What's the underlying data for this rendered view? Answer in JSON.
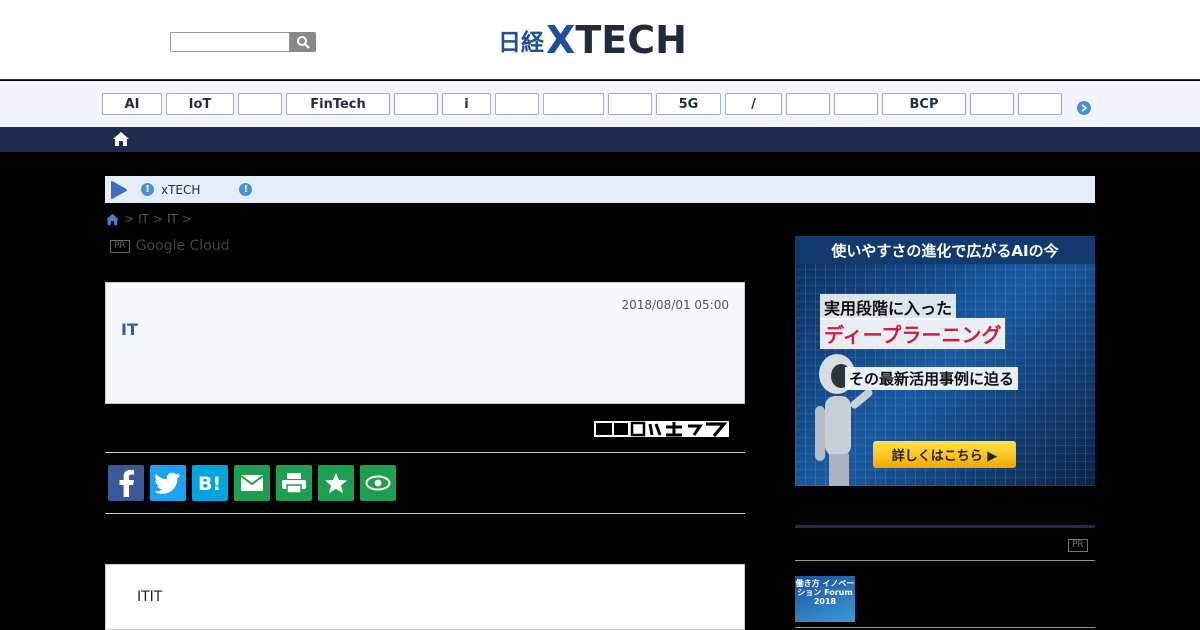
{
  "header": {
    "search_placeholder": "",
    "logo_nikkei": "日経",
    "logo_x": "X",
    "logo_tech": "TECH"
  },
  "categories": [
    "AI",
    "IoT",
    "",
    "FinTech",
    "",
    "i",
    "",
    "",
    "",
    "5G",
    "/",
    "",
    "",
    "BCP",
    "",
    ""
  ],
  "notice": {
    "label": "xTECH"
  },
  "breadcrumb": {
    "items": [
      "IT",
      "IT"
    ],
    "sep": ">"
  },
  "pr": {
    "badge": "PR",
    "text": "Google Cloud"
  },
  "article": {
    "date": "2018/08/01 05:00",
    "title": "IT",
    "body": "ITIT"
  },
  "share_buttons": [
    "facebook",
    "twitter",
    "hatena",
    "mail",
    "print",
    "favorite",
    "watch"
  ],
  "ad": {
    "headline": "使いやすさの進化で広がるAIの今",
    "line1": "実用段階に入った",
    "line2": "ディープラーニング",
    "line3": "その最新活用事例に迫る",
    "cta": "詳しくはこちら ▶"
  },
  "side": {
    "pr_badge": "PR",
    "thumb_text": "働き方 イノベーション Forum 2018"
  },
  "colors": {
    "navy": "#1f2c4c",
    "accent": "#4a90d9",
    "share_green": "#1e9e50",
    "facebook": "#3b5998",
    "twitter": "#1da1f2",
    "hatena": "#00a4de"
  }
}
